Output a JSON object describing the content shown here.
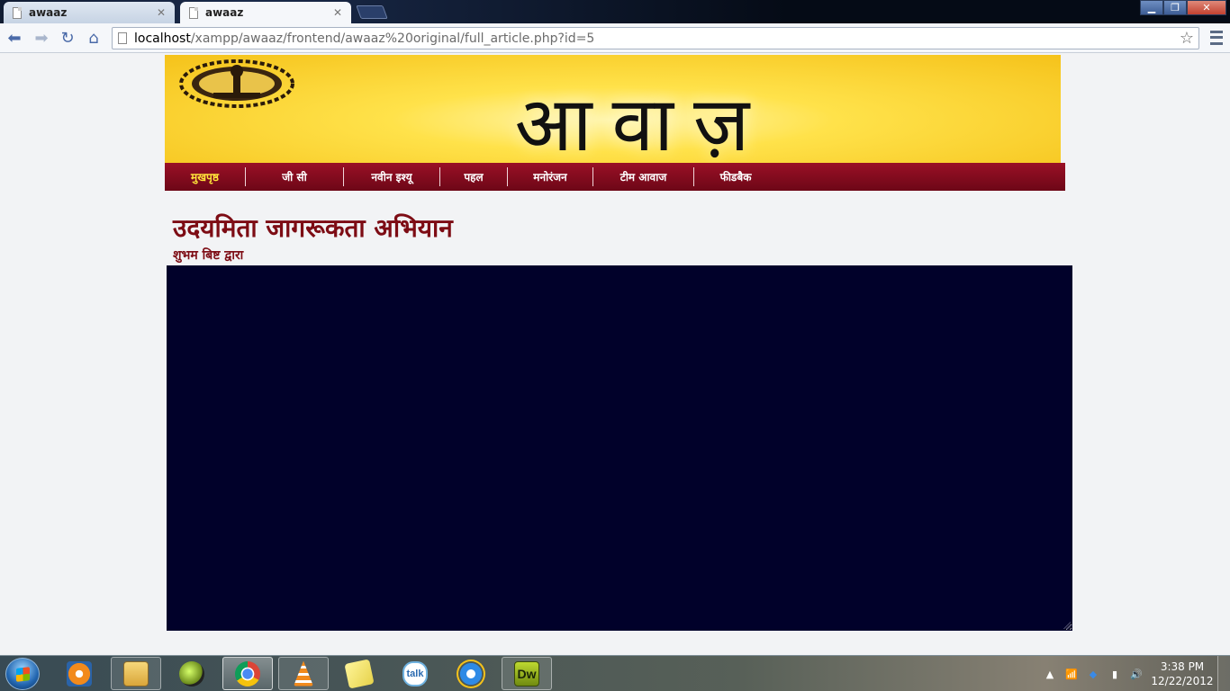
{
  "browser": {
    "tabs": [
      {
        "title": "awaaz",
        "active": false
      },
      {
        "title": "awaaz",
        "active": true
      }
    ],
    "url_host": "localhost",
    "url_path": "/xampp/awaaz/frontend/awaaz%20original/full_article.php?id=5",
    "icons": {
      "back": "back-arrow-icon",
      "forward": "forward-arrow-icon",
      "reload": "reload-icon",
      "home": "home-icon",
      "bookmark": "star-icon",
      "menu": "wrench-menu-icon"
    }
  },
  "banner": {
    "masthead": "आवाज़",
    "logo": "institute-seal-logo",
    "colors": {
      "primary": "#f5c21a",
      "glow": "#fff6b0"
    }
  },
  "nav": {
    "items": [
      "मुखपृष्ठ",
      "जी सी",
      "नवीन इश्यू",
      "पहल",
      "मनोरंजन",
      "टीम आवाज",
      "फीडबैक"
    ],
    "colors": {
      "bar": "#7d0c1c",
      "active_text": "#ffe43a"
    }
  },
  "article": {
    "title": "उदयमिता जागरूकता अभियान",
    "byline": "शुभम बिष्ट द्वारा",
    "body_bg": "#01012a"
  },
  "taskbar": {
    "apps": [
      "windows-media-player-icon",
      "explorer-icon",
      "alarm-clock-icon",
      "chrome-icon",
      "vlc-icon",
      "sticky-notes-icon",
      "google-talk-icon",
      "internet-explorer-icon",
      "dreamweaver-icon"
    ],
    "dreamweaver_label": "Dw",
    "talk_label": "talk",
    "clock": {
      "time": "3:38 PM",
      "date": "12/22/2012"
    }
  }
}
